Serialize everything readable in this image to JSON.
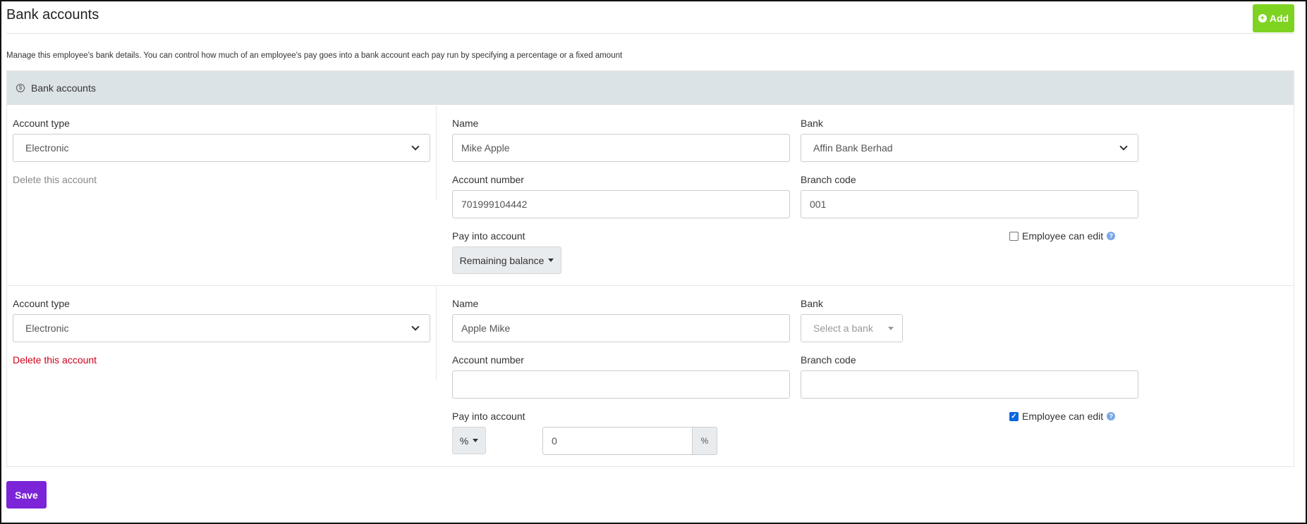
{
  "header": {
    "title": "Bank accounts",
    "add_label": "Add",
    "description": "Manage this employee's bank details. You can control how much of an employee's pay goes into a bank account each pay run by specifying a percentage or a fixed amount"
  },
  "panel": {
    "title": "Bank accounts"
  },
  "labels": {
    "account_type": "Account type",
    "name": "Name",
    "bank": "Bank",
    "account_number": "Account number",
    "branch_code": "Branch code",
    "pay_into_account": "Pay into account",
    "employee_can_edit": "Employee can edit",
    "delete_account": "Delete this account"
  },
  "accounts": [
    {
      "account_type": "Electronic",
      "name": "Mike Apple",
      "bank": "Affin Bank Berhad",
      "account_number": "701999104442",
      "branch_code": "001",
      "pay_mode": "Remaining balance",
      "employee_can_edit": false
    },
    {
      "account_type": "Electronic",
      "name": "Apple Mike",
      "bank_placeholder": "Select a bank",
      "account_number": "",
      "branch_code": "",
      "pay_mode": "%",
      "pay_value": "0",
      "pay_unit": "%",
      "employee_can_edit": true
    }
  ],
  "footer": {
    "save_label": "Save"
  },
  "colors": {
    "add": "#7ed321",
    "save": "#7b24d8",
    "delete": "#d0021b",
    "panel_head": "#dce3e6"
  }
}
